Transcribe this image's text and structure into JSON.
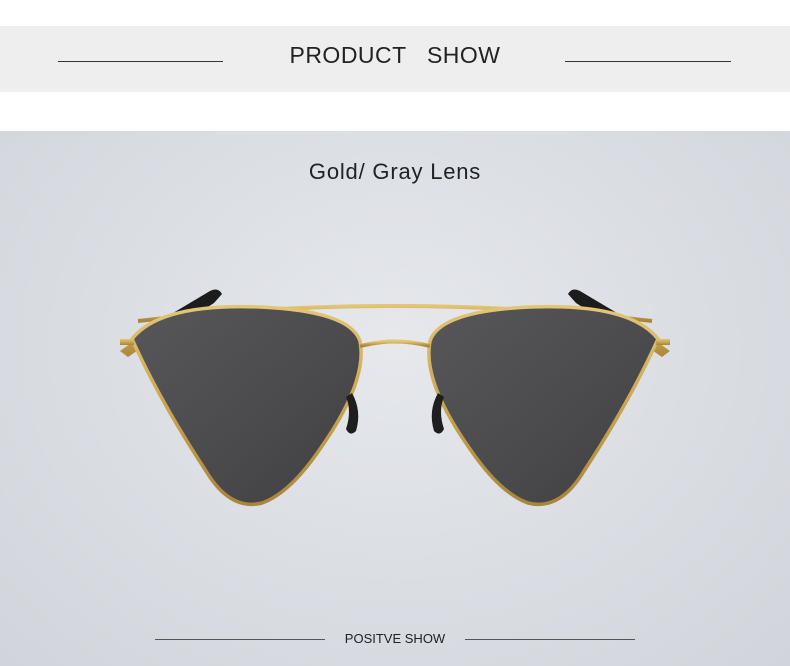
{
  "banner": {
    "title": "PRODUCT   SHOW"
  },
  "product": {
    "caption": "Gold/ Gray Lens",
    "frame_color": "#c9a64e",
    "lens_color": "#4a4a4d"
  },
  "footer": {
    "label": "POSITVE SHOW"
  }
}
